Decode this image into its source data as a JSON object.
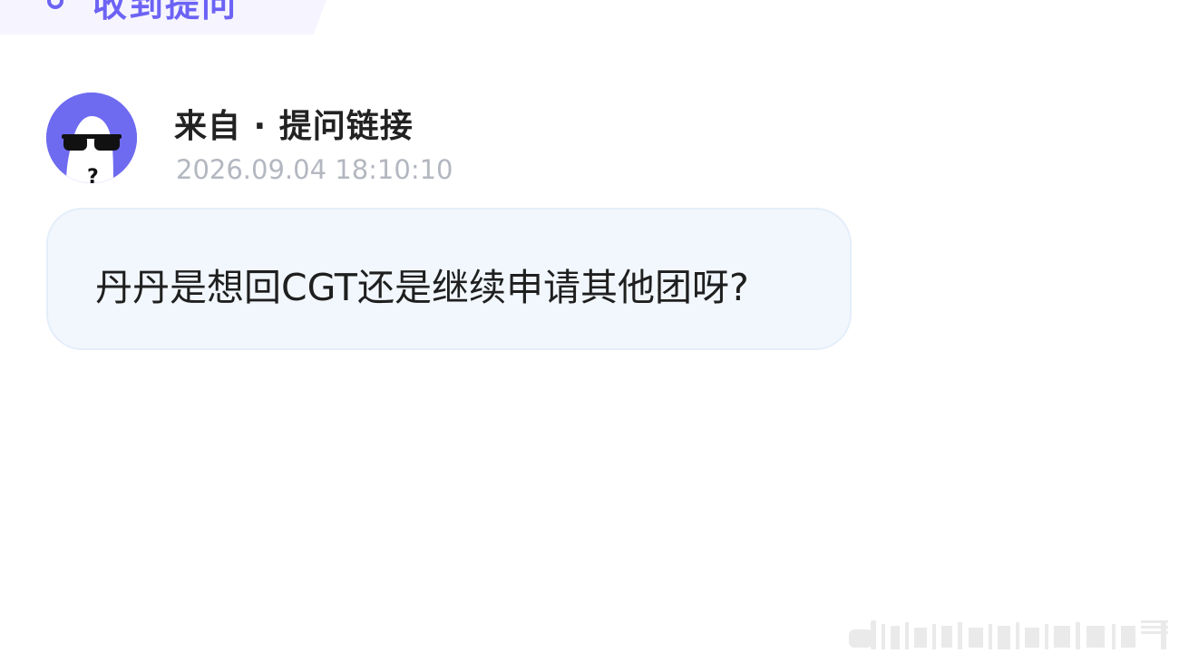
{
  "header": {
    "tab_label": "收到提问"
  },
  "sender": {
    "name": "来自 · 提问链接",
    "timestamp": "2026.09.04 18:10:10",
    "avatar_icon": "anonymous-sunglasses-avatar"
  },
  "message": {
    "text": "丹丹是想回CGT还是继续申请其他团呀?"
  },
  "colors": {
    "accent": "#6c63f5",
    "avatar_bg": "#6e6bf0",
    "bubble_bg": "#f2f7fd",
    "timestamp": "#b3b7c0"
  }
}
